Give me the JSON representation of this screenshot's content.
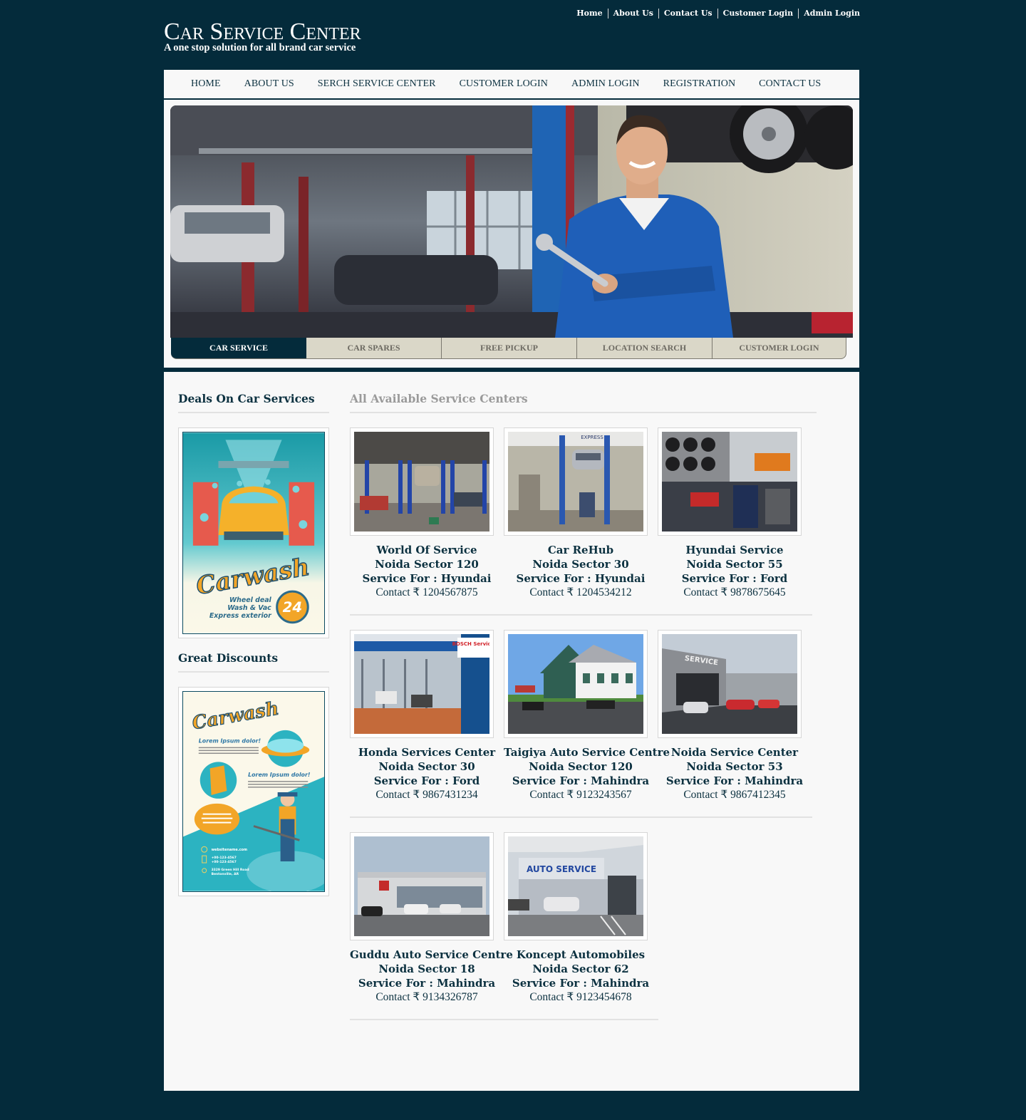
{
  "site": {
    "title": "Car Service Center",
    "tagline": "A one stop solution for all brand car service"
  },
  "top_links": [
    "Home",
    "About Us",
    "Contact Us",
    "Customer Login",
    "Admin Login"
  ],
  "nav": [
    "HOME",
    "ABOUT US",
    "SERCH SERVICE CENTER",
    "CUSTOMER LOGIN",
    "ADMIN LOGIN",
    "REGISTRATION",
    "CONTACT US"
  ],
  "hero_tabs": [
    {
      "label": "CAR SERVICE",
      "active": true
    },
    {
      "label": "CAR SPARES",
      "active": false
    },
    {
      "label": "FREE PICKUP",
      "active": false
    },
    {
      "label": "LOCATION SEARCH",
      "active": false
    },
    {
      "label": "CUSTOMER LOGIN",
      "active": false
    }
  ],
  "sidebar": {
    "deals_heading": "Deals On Car Services",
    "discounts_heading": "Great Discounts",
    "ad1": {
      "brand": "Carwash",
      "lines": [
        "Wheel deal",
        "Wash & Vac",
        "Express exterior"
      ],
      "badge": "24"
    },
    "ad2": {
      "brand": "Carwash",
      "headline1": "Lorem Ipsum dolor!",
      "headline2": "Lorem Ipsum dolor!",
      "website": "websitename.com",
      "phone1": "+00-123-4567",
      "phone2": "+00-123-4567",
      "address1": "3329 Green Hill Road",
      "address2": "Bentonville, AR"
    }
  },
  "main": {
    "heading": "All Available Service Centers",
    "centers": [
      {
        "name": "World Of Service",
        "location": "Noida Sector 120",
        "service_for": "Service For : Hyundai",
        "contact": "Contact ₹ 1204567875"
      },
      {
        "name": "Car ReHub",
        "location": "Noida Sector 30",
        "service_for": "Service For : Hyundai",
        "contact": "Contact ₹ 1204534212"
      },
      {
        "name": "Hyundai Service",
        "location": "Noida Sector 55",
        "service_for": "Service For : Ford",
        "contact": "Contact ₹ 9878675645"
      },
      {
        "name": "Honda Services Center",
        "location": "Noida Sector 30",
        "service_for": "Service For : Ford",
        "contact": "Contact ₹ 9867431234"
      },
      {
        "name": "Taigiya Auto Service Centre",
        "location": "Noida Sector 120",
        "service_for": "Service For : Mahindra",
        "contact": "Contact ₹ 9123243567"
      },
      {
        "name": "Noida Service Center",
        "location": "Noida Sector 53",
        "service_for": "Service For : Mahindra",
        "contact": "Contact ₹ 9867412345"
      },
      {
        "name": "Guddu Auto Service Centre",
        "location": "Noida Sector 18",
        "service_for": "Service For : Mahindra",
        "contact": "Contact ₹ 9134326787"
      },
      {
        "name": "Koncept Automobiles",
        "location": "Noida Sector 62",
        "service_for": "Service For : Mahindra",
        "contact": "Contact ₹ 9123454678"
      }
    ],
    "thumb_signs": {
      "express": "EXPRESS",
      "bosch": "BOSCH Service",
      "service": "SERVICE",
      "auto_service": "AUTO SERVICE"
    }
  },
  "colors": {
    "brand_dark": "#042b3b",
    "tab_inactive": "#dad7c8",
    "page_bg": "#f8f8f8"
  }
}
